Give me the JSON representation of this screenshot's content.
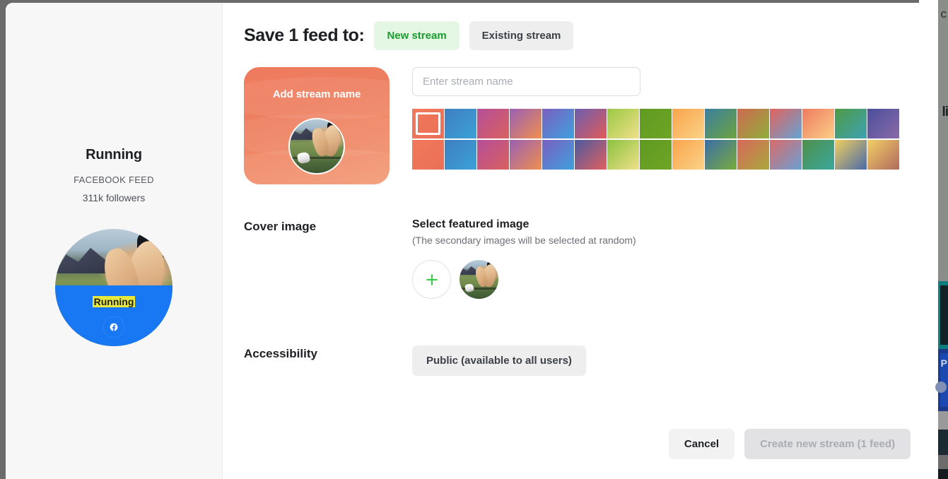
{
  "modal": {
    "header": {
      "title": "Save 1 feed to:",
      "tabs": [
        {
          "label": "New stream",
          "state": "active"
        },
        {
          "label": "Existing stream",
          "state": "idle"
        }
      ]
    },
    "preview_card": {
      "label": "Add stream name",
      "selected_color": "#ef7a5e"
    },
    "stream_name": {
      "value": "",
      "placeholder": "Enter stream name"
    },
    "color_swatches": {
      "selected_index": 0,
      "row1": [
        "linear-gradient(135deg,#f2795a 0%,#ea6f58 100%)",
        "linear-gradient(135deg,#3f7fc1 0%,#3ba1d8 100%)",
        "linear-gradient(135deg,#b54f9a 0%,#d9605e 100%)",
        "linear-gradient(135deg,#9a5fb4 0%,#ef8f4e 100%)",
        "linear-gradient(135deg,#7a5fc0 0%,#3ea0dd 100%)",
        "linear-gradient(135deg,#6a5fae 0%,#e25a58 100%)",
        "linear-gradient(135deg,#9cc843 0%,#efe08a 100%)",
        "linear-gradient(135deg,#5f9a20 0%,#6fa526 100%)",
        "linear-gradient(135deg,#f9a44c 0%,#fbd287 100%)",
        "linear-gradient(135deg,#3a7fa0 0%,#6da33f 100%)",
        "linear-gradient(135deg,#cf6a4f 0%,#8fae3c 100%)",
        "linear-gradient(135deg,#e2625e 0%,#63a4d4 100%)",
        "linear-gradient(135deg,#ef7b62 0%,#fbce85 100%)",
        "linear-gradient(135deg,#4e9a45 0%,#3ea2b4 100%)",
        "linear-gradient(135deg,#4a4f9c 0%,#8a6aa8 100%)",
        ""
      ],
      "row2": [
        "linear-gradient(135deg,#f2795a 0%,#ea6f58 100%)",
        "linear-gradient(135deg,#3f7fc1 0%,#3ba1d8 100%)",
        "linear-gradient(135deg,#b54f9a 0%,#d9605e 100%)",
        "linear-gradient(135deg,#9a5fb4 0%,#ef8f4e 100%)",
        "linear-gradient(135deg,#7a5fc0 0%,#3ea0dd 100%)",
        "linear-gradient(135deg,#4b5aa0 0%,#e2605e 100%)",
        "linear-gradient(135deg,#8bc23e 0%,#efe08a 100%)",
        "linear-gradient(135deg,#5f9a20 0%,#6fa526 100%)",
        "linear-gradient(135deg,#f9a44c 0%,#fbd287 100%)",
        "linear-gradient(135deg,#3a6ea8 0%,#79ab3c 100%)",
        "linear-gradient(135deg,#d9675a 0%,#a8a83c 100%)",
        "linear-gradient(135deg,#da6a6a 0%,#6aa0d4 100%)",
        "linear-gradient(135deg,#4f8f4a 0%,#3aa79c 100%)",
        "linear-gradient(135deg,#f0cf60 0%,#4a6aa8 100%)",
        "linear-gradient(135deg,#f3cf66 0%,#b06a5e 100%)",
        ""
      ]
    },
    "cover_image": {
      "label": "Cover image",
      "sub_title": "Select featured image",
      "note": "(The secondary images will be selected at random)",
      "add_icon": "plus-icon",
      "add_icon_color": "#2ecc40"
    },
    "accessibility": {
      "label": "Accessibility",
      "value": "Public (available to all users)"
    },
    "footer": {
      "cancel_label": "Cancel",
      "create_label": "Create new stream (1 feed)"
    }
  },
  "sidebar": {
    "feed_title": "Running",
    "feed_source": "FACEBOOK FEED",
    "followers": "311k followers",
    "avatar_label": "Running",
    "network_icon": "facebook-icon",
    "network_color": "#1877f2"
  },
  "background": {
    "letter": "li",
    "letter2": "c",
    "letter3": "P"
  }
}
